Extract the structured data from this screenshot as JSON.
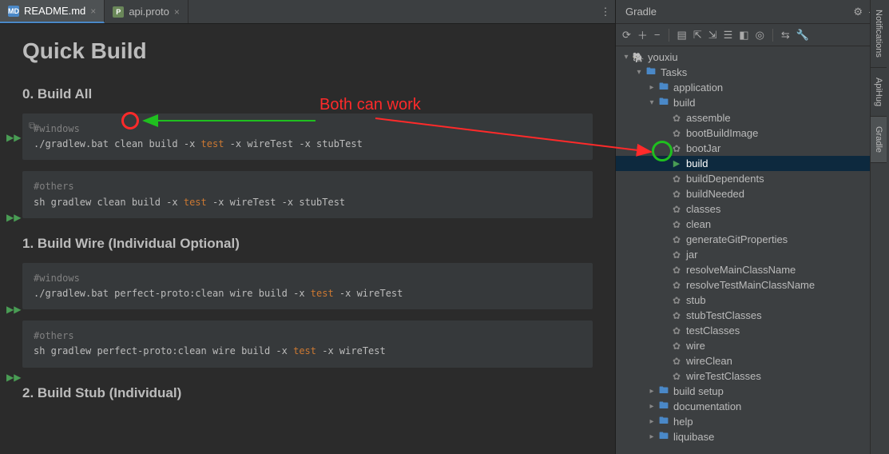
{
  "tabs": [
    {
      "label": "README.md",
      "active": true,
      "iconClass": "md-icon",
      "iconText": "MD"
    },
    {
      "label": "api.proto",
      "active": false,
      "iconClass": "proto-icon",
      "iconText": "P"
    }
  ],
  "doc": {
    "title": "Quick Build",
    "s0": {
      "heading": "0. Build All",
      "b1_comment": "#windows",
      "b1_cmd_a": "./gradlew.bat clean build -x ",
      "b1_kw": "test",
      "b1_cmd_b": " -x wireTest -x stubTest",
      "b2_comment": "#others",
      "b2_cmd_a": "sh gradlew clean build -x ",
      "b2_kw": "test",
      "b2_cmd_b": " -x wireTest -x stubTest"
    },
    "s1": {
      "heading": "1. Build Wire (Individual Optional)",
      "b1_comment": "#windows",
      "b1_cmd_a": "./gradlew.bat perfect-proto:clean wire build -x ",
      "b1_kw": "test",
      "b1_cmd_b": " -x wireTest",
      "b2_comment": "#others",
      "b2_cmd_a": "sh gradlew perfect-proto:clean wire build -x ",
      "b2_kw": "test",
      "b2_cmd_b": " -x wireTest"
    },
    "s2": {
      "heading": "2. Build Stub (Individual)"
    }
  },
  "gradle": {
    "title": "Gradle",
    "root": "youxiu",
    "nodes": {
      "tasks": "Tasks",
      "application": "application",
      "build": "build",
      "build_setup": "build setup",
      "documentation": "documentation",
      "help": "help",
      "liquibase": "liquibase"
    },
    "build_tasks": [
      "assemble",
      "bootBuildImage",
      "bootJar",
      "build",
      "buildDependents",
      "buildNeeded",
      "classes",
      "clean",
      "generateGitProperties",
      "jar",
      "resolveMainClassName",
      "resolveTestMainClassName",
      "stub",
      "stubTestClasses",
      "testClasses",
      "wire",
      "wireClean",
      "wireTestClasses"
    ],
    "selected_task": "build"
  },
  "strip": [
    "Notifications",
    "ApiHug",
    "Gradle"
  ],
  "annotation": {
    "label": "Both can work"
  }
}
